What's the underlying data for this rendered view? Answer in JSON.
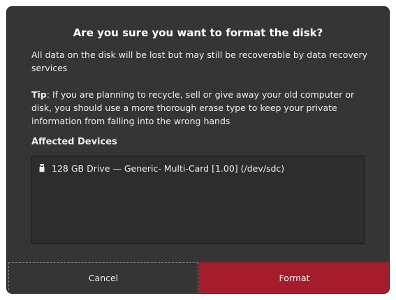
{
  "dialog": {
    "title": "Are you sure you want to format the disk?",
    "warning": "All data on the disk will be lost but may still be recoverable by data recovery services",
    "tip_label": "Tip",
    "tip_text": ": If you are planning to recycle, sell or give away your old computer or disk, you should use a more thorough erase type to keep your private information from falling into the wrong hands",
    "devices_heading": "Affected Devices",
    "devices": [
      {
        "icon": "usb-drive-icon",
        "label": "128 GB Drive — Generic- Multi-Card [1.00] (/dev/sdc)"
      }
    ],
    "cancel_label": "Cancel",
    "format_label": "Format"
  },
  "colors": {
    "dialog_bg": "#353535",
    "list_bg": "#2d2d2d",
    "destructive": "#a51d2d",
    "text": "#eeeeec"
  }
}
